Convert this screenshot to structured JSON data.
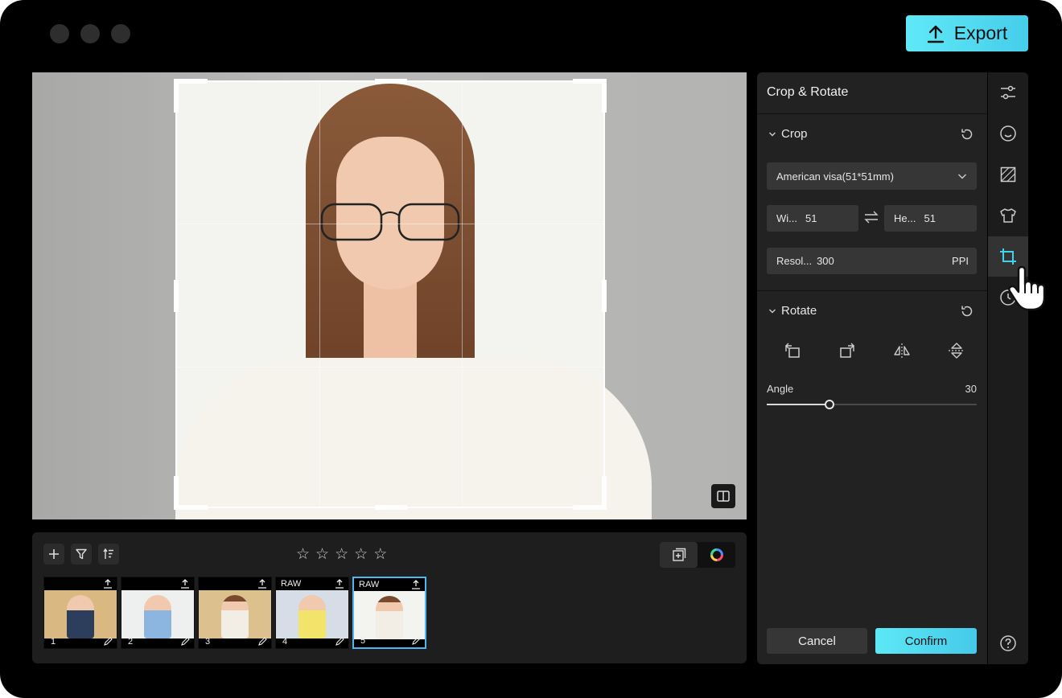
{
  "window": {
    "controls": [
      "close",
      "minimize",
      "maximize"
    ]
  },
  "toolbar": {
    "export_label": "Export",
    "export_icon": "upload-icon"
  },
  "colors": {
    "accent_start": "#5fe9f7",
    "accent_end": "#46cdea",
    "selection_border": "#4fb6f0"
  },
  "panel": {
    "title": "Crop & Rotate",
    "crop": {
      "heading": "Crop",
      "preset": "American visa(51*51mm)",
      "width_label": "Wi...",
      "width_value": "51",
      "height_label": "He...",
      "height_value": "51",
      "resolution_label": "Resol...",
      "resolution_value": "300",
      "resolution_unit": "PPI"
    },
    "rotate": {
      "heading": "Rotate",
      "angle_label": "Angle",
      "angle_value": "30",
      "angle_fraction": 0.3
    },
    "cancel_label": "Cancel",
    "confirm_label": "Confirm"
  },
  "rail": {
    "items": [
      "sliders-icon",
      "face-icon",
      "exposure-icon",
      "clothing-icon",
      "crop-icon",
      "history-icon"
    ],
    "active": "crop-icon",
    "help_icon": "help-icon"
  },
  "filmstrip": {
    "tools": [
      "add-icon",
      "filter-icon",
      "sort-icon"
    ],
    "rating_stars": 5,
    "rating_value": 0,
    "thumbnails": [
      {
        "number": "1",
        "badge": "",
        "selected": false
      },
      {
        "number": "2",
        "badge": "",
        "selected": false
      },
      {
        "number": "3",
        "badge": "",
        "selected": false
      },
      {
        "number": "4",
        "badge": "RAW",
        "selected": false
      },
      {
        "number": "5",
        "badge": "RAW",
        "selected": true
      }
    ]
  }
}
